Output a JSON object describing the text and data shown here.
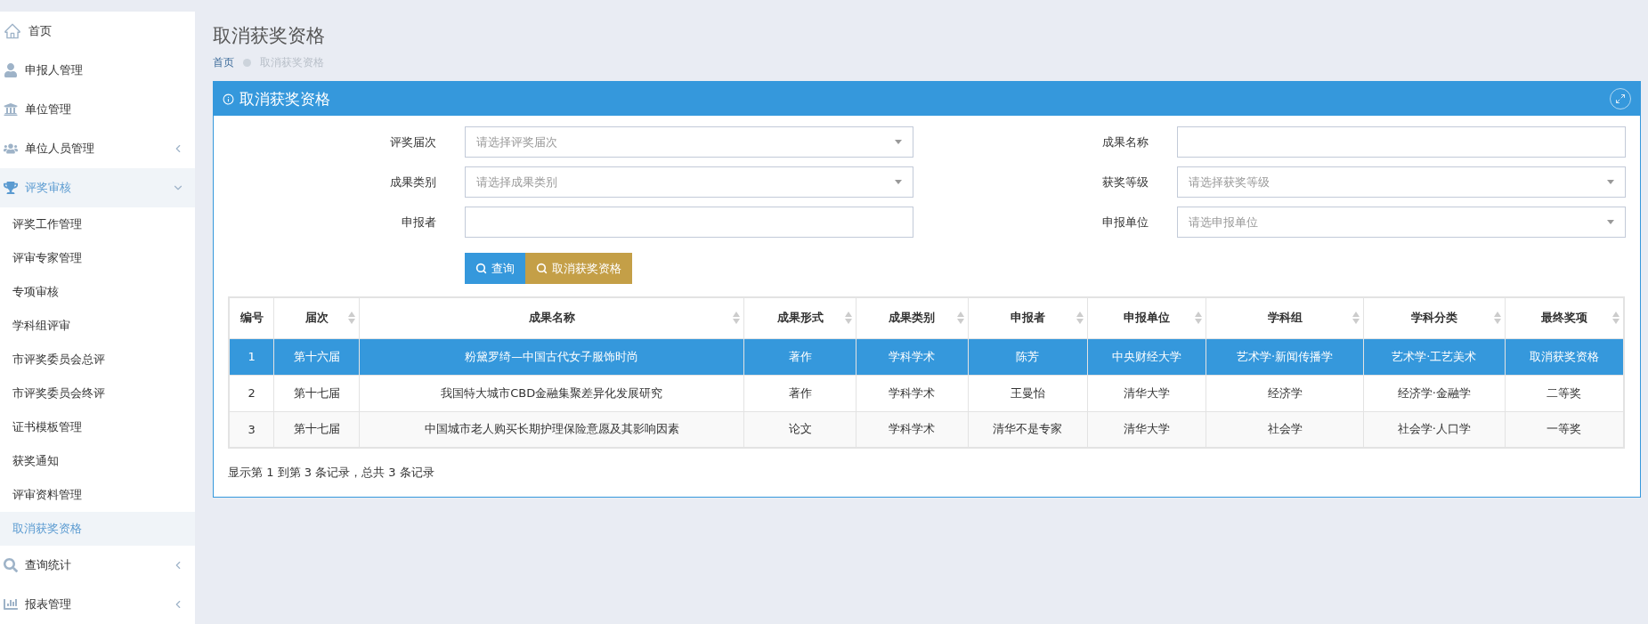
{
  "sidebar": {
    "items": [
      {
        "label": "首页",
        "kind": "link",
        "selected": false
      },
      {
        "label": "申报人管理",
        "kind": "link",
        "selected": false
      },
      {
        "label": "单位管理",
        "kind": "link",
        "selected": false
      },
      {
        "label": "单位人员管理",
        "kind": "group",
        "selected": false,
        "expanded": false
      },
      {
        "label": "评奖审核",
        "kind": "group",
        "selected": true,
        "expanded": true,
        "children": [
          {
            "label": "评奖工作管理",
            "selected": false
          },
          {
            "label": "评审专家管理",
            "selected": false
          },
          {
            "label": "专项审核",
            "selected": false
          },
          {
            "label": "学科组评审",
            "selected": false
          },
          {
            "label": "市评奖委员会总评",
            "selected": false
          },
          {
            "label": "市评奖委员会终评",
            "selected": false
          },
          {
            "label": "证书模板管理",
            "selected": false
          },
          {
            "label": "获奖通知",
            "selected": false
          },
          {
            "label": "评审资料管理",
            "selected": false
          },
          {
            "label": "取消获奖资格",
            "selected": true
          }
        ]
      },
      {
        "label": "查询统计",
        "kind": "group",
        "selected": false,
        "expanded": false
      },
      {
        "label": "报表管理",
        "kind": "group",
        "selected": false,
        "expanded": false
      }
    ]
  },
  "page": {
    "title": "取消获奖资格",
    "breadcrumb": [
      {
        "label": "首页",
        "kind": "link"
      },
      {
        "label": "取消获奖资格",
        "kind": "current"
      }
    ]
  },
  "panel": {
    "title": "取消获奖资格",
    "fields": [
      {
        "label": "评奖届次",
        "kind": "select",
        "placeholder": "请选择评奖届次"
      },
      {
        "label": "成果名称",
        "kind": "input"
      },
      {
        "label": "成果类别",
        "kind": "select",
        "placeholder": "请选择成果类别"
      },
      {
        "label": "获奖等级",
        "kind": "select",
        "placeholder": "请选择获奖等级"
      },
      {
        "label": "申报者",
        "kind": "input"
      },
      {
        "label": "申报单位",
        "kind": "select",
        "placeholder": "请选申报单位"
      }
    ],
    "buttons": [
      {
        "label": "查询",
        "kind": "primary"
      },
      {
        "label": "取消获奖资格",
        "kind": "warning"
      }
    ],
    "table": {
      "columns": [
        {
          "label": "编号",
          "sortable": false
        },
        {
          "label": "届次",
          "sortable": true
        },
        {
          "label": "成果名称",
          "sortable": true
        },
        {
          "label": "成果形式",
          "sortable": true
        },
        {
          "label": "成果类别",
          "sortable": true
        },
        {
          "label": "申报者",
          "sortable": true
        },
        {
          "label": "申报单位",
          "sortable": true
        },
        {
          "label": "学科组",
          "sortable": true
        },
        {
          "label": "学科分类",
          "sortable": true
        },
        {
          "label": "最终奖项",
          "sortable": true
        }
      ],
      "rows": [
        {
          "selected": true,
          "cells": [
            "1",
            "第十六届",
            "粉黛罗绮—中国古代女子服饰时尚",
            "著作",
            "学科学术",
            "陈芳",
            "中央财经大学",
            "艺术学·新闻传播学",
            "艺术学·工艺美术",
            "取消获奖资格"
          ]
        },
        {
          "selected": false,
          "cells": [
            "2",
            "第十七届",
            "我国特大城市CBD金融集聚差异化发展研究",
            "著作",
            "学科学术",
            "王曼怡",
            "清华大学",
            "经济学",
            "经济学·金融学",
            "二等奖"
          ]
        },
        {
          "selected": false,
          "cells": [
            "3",
            "第十七届",
            "中国城市老人购买长期护理保险意愿及其影响因素",
            "论文",
            "学科学术",
            "清华不是专家",
            "清华大学",
            "社会学",
            "社会学·人口学",
            "一等奖"
          ]
        }
      ]
    },
    "footer": "显示第 1 到第 3 条记录，总共 3 条记录"
  }
}
